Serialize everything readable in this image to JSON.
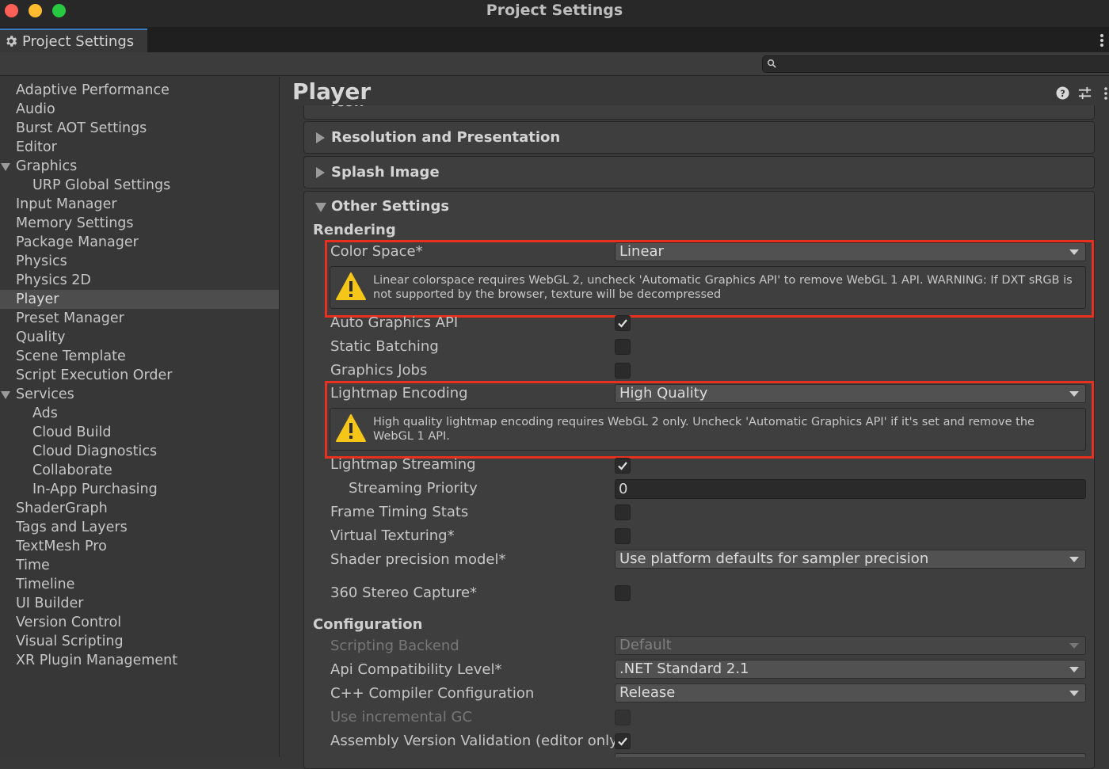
{
  "window": {
    "title": "Project Settings"
  },
  "tab": {
    "label": "Project Settings"
  },
  "search": {
    "placeholder": ""
  },
  "sidebar": {
    "items": [
      "Adaptive Performance",
      "Audio",
      "Burst AOT Settings",
      "Editor",
      "Graphics",
      "URP Global Settings",
      "Input Manager",
      "Memory Settings",
      "Package Manager",
      "Physics",
      "Physics 2D",
      "Player",
      "Preset Manager",
      "Quality",
      "Scene Template",
      "Script Execution Order",
      "Services",
      "Ads",
      "Cloud Build",
      "Cloud Diagnostics",
      "Collaborate",
      "In-App Purchasing",
      "ShaderGraph",
      "Tags and Layers",
      "TextMesh Pro",
      "Time",
      "Timeline",
      "UI Builder",
      "Version Control",
      "Visual Scripting",
      "XR Plugin Management"
    ],
    "selected": "Player"
  },
  "inspector": {
    "title": "Player",
    "sections": {
      "icon": "Icon",
      "resolution": "Resolution and Presentation",
      "splash": "Splash Image",
      "other": "Other Settings"
    },
    "rendering": {
      "header": "Rendering",
      "color_space": {
        "label": "Color Space*",
        "value": "Linear"
      },
      "color_space_warning": "Linear colorspace requires WebGL 2, uncheck 'Automatic Graphics API' to remove WebGL 1 API. WARNING: If DXT sRGB is not supported by the browser, texture will be decompressed",
      "auto_graphics_api": {
        "label": "Auto Graphics API",
        "checked": true
      },
      "static_batching": {
        "label": "Static Batching",
        "checked": false
      },
      "graphics_jobs": {
        "label": "Graphics Jobs",
        "checked": false
      },
      "lightmap_encoding": {
        "label": "Lightmap Encoding",
        "value": "High Quality"
      },
      "lightmap_warning": "High quality lightmap encoding requires WebGL 2 only. Uncheck 'Automatic Graphics API' if it's set and remove the WebGL 1 API.",
      "lightmap_streaming": {
        "label": "Lightmap Streaming",
        "checked": true
      },
      "streaming_priority": {
        "label": "Streaming Priority",
        "value": "0"
      },
      "frame_timing_stats": {
        "label": "Frame Timing Stats",
        "checked": false
      },
      "virtual_texturing": {
        "label": "Virtual Texturing*",
        "checked": false
      },
      "shader_precision": {
        "label": "Shader precision model*",
        "value": "Use platform defaults for sampler precision"
      },
      "stereo_capture": {
        "label": "360 Stereo Capture*",
        "checked": false
      }
    },
    "configuration": {
      "header": "Configuration",
      "scripting_backend": {
        "label": "Scripting Backend",
        "value": "Default"
      },
      "api_compat": {
        "label": "Api Compatibility Level*",
        "value": ".NET Standard 2.1"
      },
      "cpp_compiler": {
        "label": "C++ Compiler Configuration",
        "value": "Release"
      },
      "incremental_gc": {
        "label": "Use incremental GC",
        "checked": false
      },
      "assembly_validation": {
        "label": "Assembly Version Validation (editor only)",
        "checked": true
      }
    }
  },
  "colors": {
    "highlight": "#e8301f",
    "warning": "#f5c518",
    "tab_accent": "#3a79bb"
  }
}
